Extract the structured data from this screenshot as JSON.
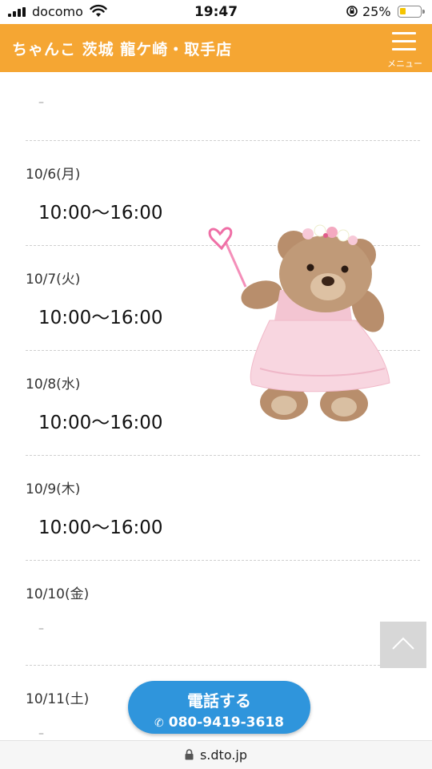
{
  "status_bar": {
    "carrier": "docomo",
    "time": "19:47",
    "battery": "25%"
  },
  "header": {
    "title": "ちゃんこ 茨城 龍ケ崎・取手店",
    "menu_label": "メニュー",
    "accent_color": "#f5a633"
  },
  "schedule": {
    "leading_hours": "–",
    "days": [
      {
        "date": "10/6(月)",
        "hours": "10:00〜16:00"
      },
      {
        "date": "10/7(火)",
        "hours": "10:00〜16:00"
      },
      {
        "date": "10/8(水)",
        "hours": "10:00〜16:00"
      },
      {
        "date": "10/9(木)",
        "hours": "10:00〜16:00"
      },
      {
        "date": "10/10(金)",
        "hours": "–"
      },
      {
        "date": "10/11(土)",
        "hours": "–"
      }
    ]
  },
  "call_button": {
    "title": "電話する",
    "phone": "080-9419-3618",
    "color": "#2f95dc"
  },
  "url_bar": {
    "domain": "s.dto.jp"
  },
  "icons": {
    "menu": "hamburger-icon",
    "to_top": "chevron-up-icon",
    "phone": "phone-icon",
    "lock": "lock-icon",
    "bear": "teddy-bear-fairy-illustration"
  }
}
